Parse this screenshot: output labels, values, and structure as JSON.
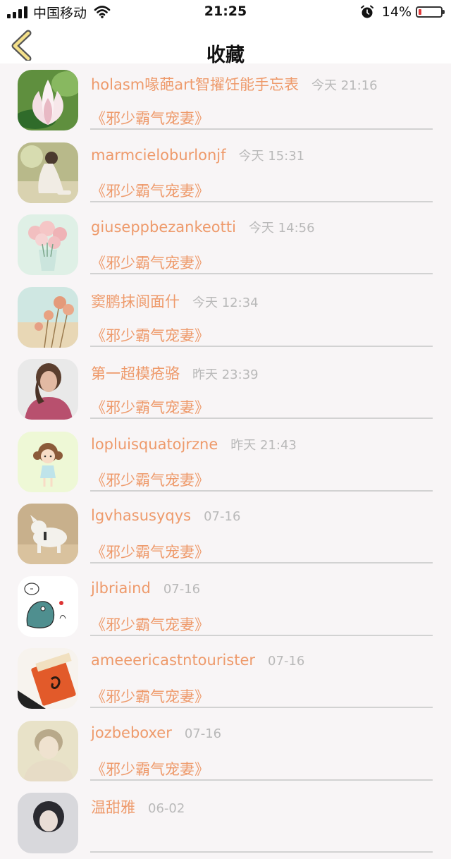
{
  "status_bar": {
    "carrier": "中国移动",
    "time": "21:25",
    "battery_percent": "14%",
    "battery_level": 0.14,
    "battery_color": "#e03a3a"
  },
  "nav": {
    "back_icon": "chevron-left-icon",
    "title": "收藏"
  },
  "colors": {
    "accent": "#ee9a6b",
    "muted": "#b9b9b9"
  },
  "favorites": [
    {
      "name": "holasm喙葩art智擢饪能手忘表",
      "time": "今天 21:16",
      "book": "《邪少霸气宠妻》"
    },
    {
      "name": "marmcieloburlonjf",
      "time": "今天 15:31",
      "book": "《邪少霸气宠妻》"
    },
    {
      "name": "giuseppbezankeotti",
      "time": "今天 14:56",
      "book": "《邪少霸气宠妻》"
    },
    {
      "name": "窦鹏抹阆面什",
      "time": "今天 12:34",
      "book": "《邪少霸气宠妻》"
    },
    {
      "name": "第一超模疮骆",
      "time": "昨天 23:39",
      "book": "《邪少霸气宠妻》"
    },
    {
      "name": "lopluisquatojrzne",
      "time": "昨天 21:43",
      "book": "《邪少霸气宠妻》"
    },
    {
      "name": "lgvhasusyqys",
      "time": "07-16",
      "book": "《邪少霸气宠妻》"
    },
    {
      "name": "jlbriaind",
      "time": "07-16",
      "book": "《邪少霸气宠妻》"
    },
    {
      "name": "ameeericastntourister",
      "time": "07-16",
      "book": "《邪少霸气宠妻》"
    },
    {
      "name": "jozbeboxer",
      "time": "07-16",
      "book": "《邪少霸气宠妻》"
    },
    {
      "name": "温甜雅",
      "time": "06-02",
      "book": ""
    }
  ]
}
